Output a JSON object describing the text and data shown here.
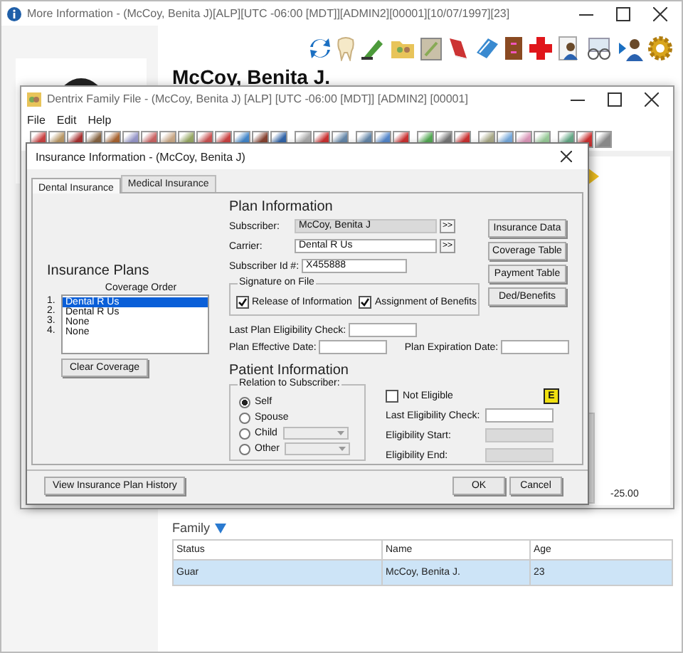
{
  "main_window": {
    "title": "More Information - (McCoy, Benita J)[ALP][UTC -06:00 [MDT]][ADMIN2][00001][10/07/1997][23]"
  },
  "patient": {
    "name": "McCoy, Benita J."
  },
  "family_file": {
    "title": "Dentrix Family File - (McCoy, Benita J) [ALP] [UTC -06:00 [MDT]] [ADMIN2] [00001]",
    "menu": [
      "File",
      "Edit",
      "Help"
    ],
    "amount": "-25.00"
  },
  "dialog": {
    "title": "Insurance Information - (McCoy, Benita J)",
    "tabs": [
      {
        "label": "Dental Insurance",
        "selected": true
      },
      {
        "label": "Medical Insurance",
        "selected": false
      }
    ],
    "insurance_plans": {
      "heading": "Insurance Plans",
      "subheading": "Coverage Order",
      "items": [
        {
          "number": "1.",
          "label": "Dental R Us",
          "selected": true
        },
        {
          "number": "2.",
          "label": "Dental R Us",
          "selected": false
        },
        {
          "number": "3.",
          "label": "None",
          "selected": false
        },
        {
          "number": "4.",
          "label": "None",
          "selected": false
        }
      ],
      "clear_button": "Clear Coverage"
    },
    "plan_information": {
      "heading": "Plan Information",
      "fields": [
        {
          "label": "Subscriber:",
          "value": "McCoy, Benita J",
          "disabled": true,
          "lookup": ">>"
        },
        {
          "label": "Carrier:",
          "value": "Dental R Us",
          "disabled": false,
          "lookup": ">>"
        },
        {
          "label": "Subscriber Id #:",
          "value": "X455888",
          "disabled": false
        }
      ],
      "buttons": [
        "Insurance Data",
        "Coverage Table",
        "Payment Table",
        "Ded/Benefits"
      ],
      "signature": {
        "legend": "Signature on File",
        "options": [
          {
            "label": "Release of Information",
            "checked": true
          },
          {
            "label": "Assignment of Benefits",
            "checked": true
          }
        ]
      },
      "last_check_label": "Last Plan Eligibility Check:",
      "effective_label": "Plan Effective Date:",
      "expiration_label": "Plan Expiration Date:"
    },
    "patient_information": {
      "heading": "Patient Information",
      "relation": {
        "legend": "Relation to Subscriber:",
        "options": [
          {
            "label": "Self",
            "selected": true,
            "dropdown": false
          },
          {
            "label": "Spouse",
            "selected": false,
            "dropdown": false
          },
          {
            "label": "Child",
            "selected": false,
            "dropdown": true
          },
          {
            "label": "Other",
            "selected": false,
            "dropdown": true
          }
        ]
      },
      "not_eligible": {
        "label": "Not Eligible",
        "checked": false
      },
      "badge": "E",
      "eligibility_fields": [
        {
          "label": "Last Eligibility Check:",
          "disabled": false
        },
        {
          "label": "Eligibility Start:",
          "disabled": true
        },
        {
          "label": "Eligibility End:",
          "disabled": true
        }
      ]
    },
    "history_button": "View Insurance Plan History",
    "ok_button": "OK",
    "cancel_button": "Cancel"
  },
  "family": {
    "heading": "Family",
    "columns": [
      "Status",
      "Name",
      "Age"
    ],
    "rows": [
      {
        "cells": [
          "Guar",
          "McCoy, Benita J.",
          "23"
        ],
        "selected": true
      }
    ]
  }
}
